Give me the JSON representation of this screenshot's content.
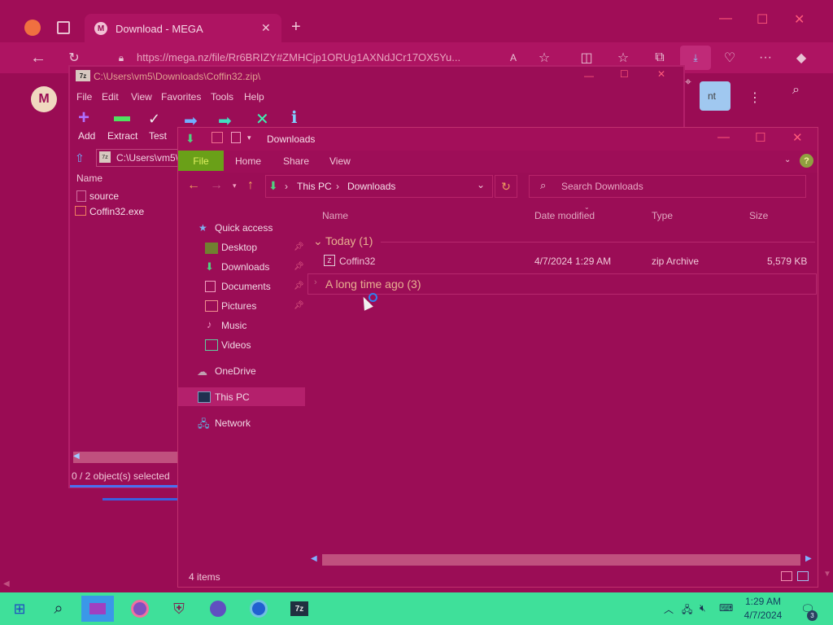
{
  "browser": {
    "tab_title": "Download - MEGA",
    "mega_tab_icon": "M",
    "url": "https://mega.nz/file/Rr6BRIZY#ZMHCjp1ORUg1AXNdJCr17OX5Yu...",
    "mega_logo": "M",
    "side_button_text": "nt"
  },
  "zip": {
    "title": "C:\\Users\\vm5\\Downloads\\Coffin32.zip\\",
    "app_icon": "7z",
    "menu": [
      "File",
      "Edit",
      "View",
      "Favorites",
      "Tools",
      "Help"
    ],
    "tools": [
      "Add",
      "Extract",
      "Test"
    ],
    "address": "C:\\Users\\vm5\\",
    "name_header": "Name",
    "items": [
      "source",
      "Coffin32.exe"
    ],
    "status": "0 / 2 object(s) selected"
  },
  "explorer": {
    "title": "Downloads",
    "ribbon": {
      "file": "File",
      "tabs": [
        "Home",
        "Share",
        "View"
      ]
    },
    "breadcrumb": [
      "This PC",
      "Downloads"
    ],
    "search_placeholder": "Search Downloads",
    "columns": {
      "name": "Name",
      "date": "Date modified",
      "type": "Type",
      "size": "Size"
    },
    "groups": {
      "today": "Today (1)",
      "long_ago": "A long time ago (3)"
    },
    "file": {
      "name": "Coffin32",
      "date": "4/7/2024 1:29 AM",
      "type": "zip Archive",
      "size": "5,579 KB"
    },
    "nav": {
      "quick_access": "Quick access",
      "desktop": "Desktop",
      "downloads": "Downloads",
      "documents": "Documents",
      "pictures": "Pictures",
      "music": "Music",
      "videos": "Videos",
      "onedrive": "OneDrive",
      "this_pc": "This PC",
      "network": "Network"
    },
    "status": "4 items"
  },
  "taskbar": {
    "time": "1:29 AM",
    "date": "4/7/2024",
    "zip_label": "7z",
    "notification_count": "3"
  },
  "colors": {
    "background": "#990a52",
    "taskbar": "#3fe09a",
    "ribbon_file": "#6aa018",
    "accent": "#ff5a7a"
  }
}
